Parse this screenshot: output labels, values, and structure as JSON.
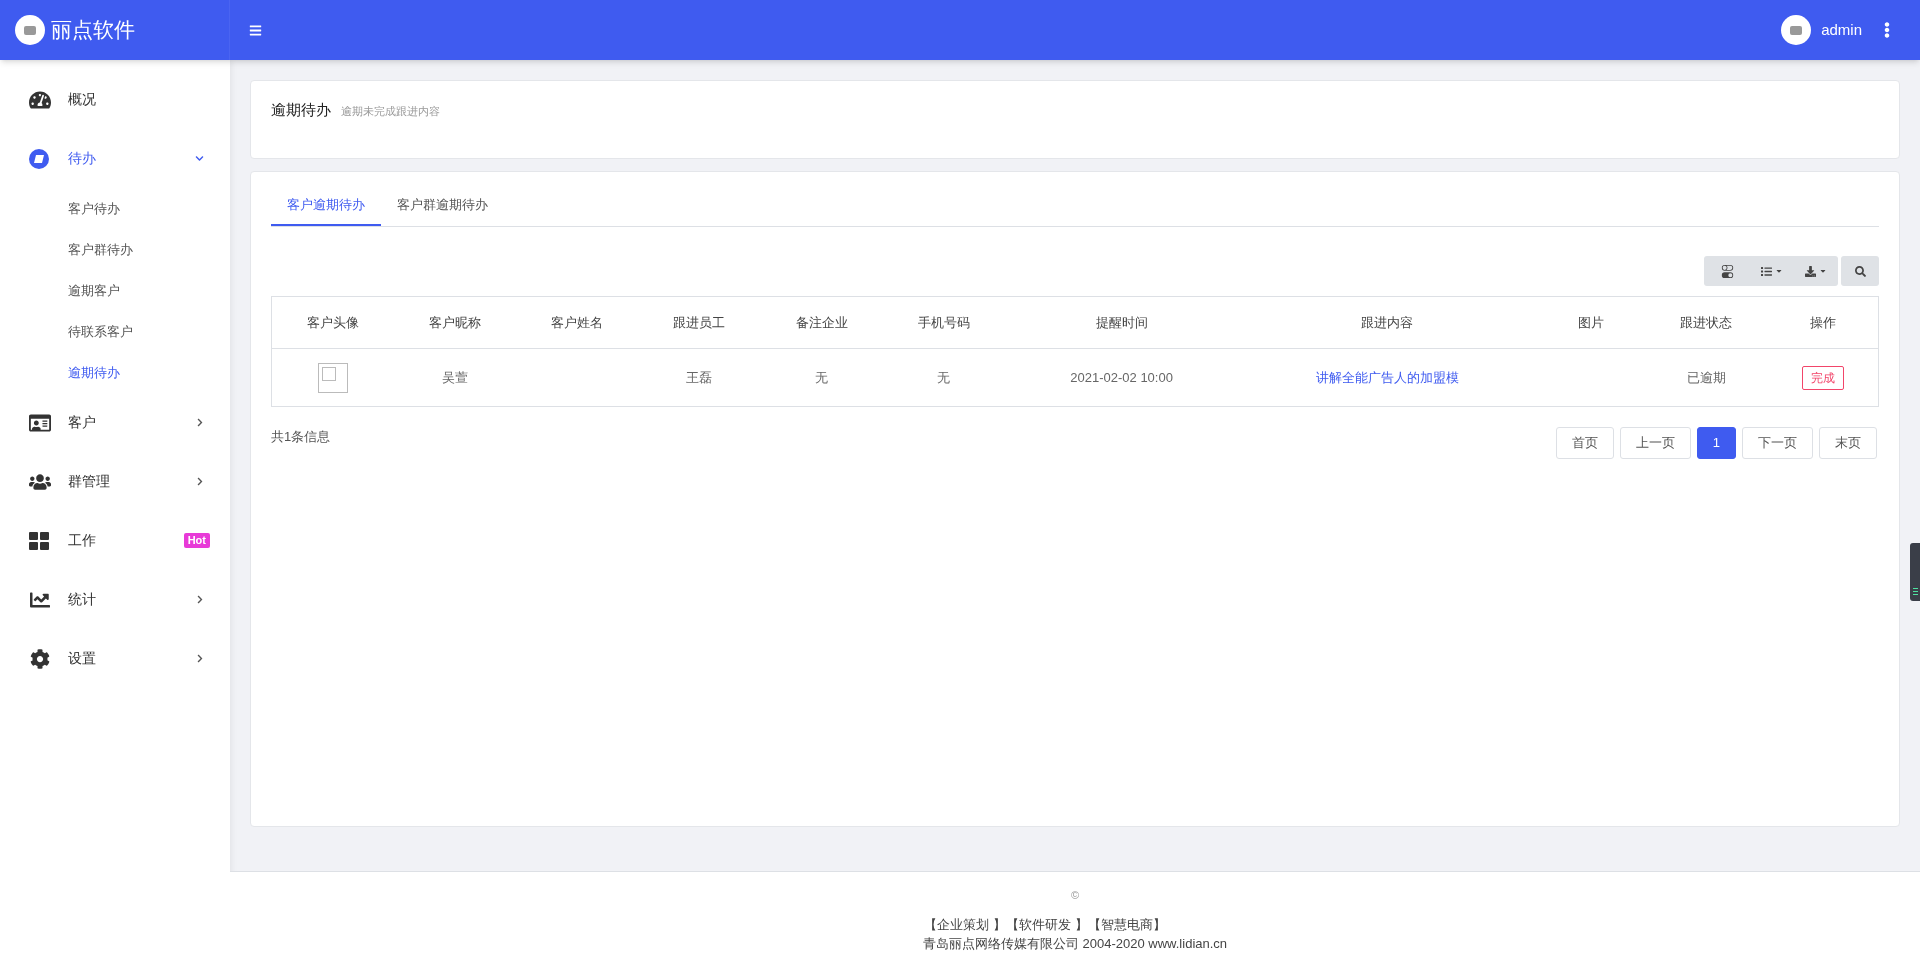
{
  "brand": {
    "name": "丽点软件"
  },
  "header": {
    "user": "admin"
  },
  "sidebar": {
    "items": [
      {
        "label": "概况",
        "selected": false
      },
      {
        "label": "待办",
        "expanded": true,
        "selected": true,
        "children": [
          {
            "label": "客户待办",
            "selected": false
          },
          {
            "label": "客户群待办",
            "selected": false
          },
          {
            "label": "逾期客户",
            "selected": false
          },
          {
            "label": "待联系客户",
            "selected": false
          },
          {
            "label": "逾期待办",
            "selected": true
          }
        ]
      },
      {
        "label": "客户",
        "expanded": false,
        "selected": false
      },
      {
        "label": "群管理",
        "expanded": false,
        "selected": false
      },
      {
        "label": "工作",
        "badge": "Hot",
        "selected": false
      },
      {
        "label": "统计",
        "expanded": false,
        "selected": false
      },
      {
        "label": "设置",
        "expanded": false,
        "selected": false
      }
    ]
  },
  "page": {
    "title": "逾期待办",
    "subtitle": "逾期未完成跟进内容"
  },
  "tabs": [
    {
      "label": "客户逾期待办",
      "selected": true
    },
    {
      "label": "客户群逾期待办",
      "selected": false
    }
  ],
  "table": {
    "columns": [
      "客户头像",
      "客户昵称",
      "客户姓名",
      "跟进员工",
      "备注企业",
      "手机号码",
      "提醒时间",
      "跟进内容",
      "图片",
      "跟进状态",
      "操作"
    ],
    "rows": [
      {
        "nickname": "吴萱",
        "staff": "王磊",
        "company": "无",
        "phone": "无",
        "time": "2021-02-02 10:00",
        "content": "讲解全能广告人的加盟模",
        "status": "已逾期",
        "action": "完成"
      }
    ]
  },
  "summary": "共1条信息",
  "pagination": [
    {
      "label": "首页",
      "selected": false
    },
    {
      "label": "上一页",
      "selected": false
    },
    {
      "label": "1",
      "selected": true
    },
    {
      "label": "下一页",
      "selected": false
    },
    {
      "label": "末页",
      "selected": false
    }
  ],
  "footer": {
    "copyright": "©",
    "links": [
      "【企业策划 】",
      "【软件研发 】",
      "【智慧电商】"
    ],
    "company": "青岛丽点网络传媒有限公司 2004-2020 www.lidian.cn"
  }
}
